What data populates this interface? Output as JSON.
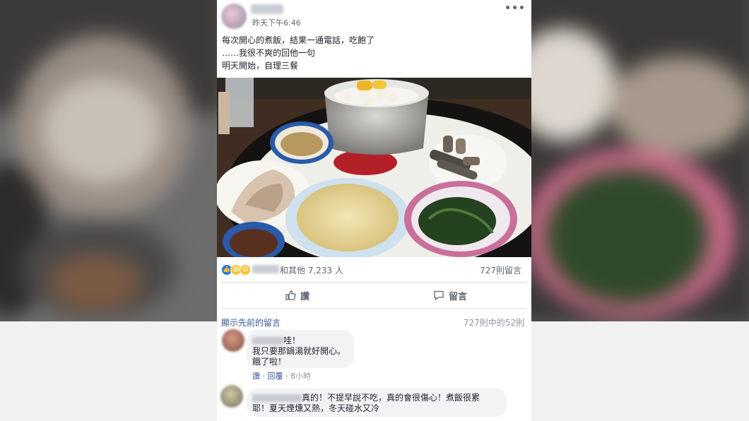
{
  "post": {
    "timestamp": "昨天下午6:46",
    "more_label": "•••",
    "text_lines": [
      "每次開心的煮飯，結果一通電話，吃飽了",
      "……我很不爽的回他一句",
      "明天開始，自理三餐"
    ]
  },
  "reactions": {
    "count_label": "和其他 7,233 人",
    "comments_label": "727則留言",
    "icons": [
      "like-icon",
      "haha-icon",
      "wow-icon"
    ]
  },
  "actions": {
    "like_label": "讚",
    "comment_label": "留言"
  },
  "comments_section": {
    "show_previous": "顯示先前的留言",
    "pager": "727則中的52則"
  },
  "comments": [
    {
      "lines": [
        "哇！",
        "我只要那鍋湯就好開心。",
        "餓了啦！"
      ],
      "like": "讚",
      "reply": "回覆",
      "time": "8小時"
    },
    {
      "lines": [
        "真的！不提早說不吃，真的會很傷心！煮飯很累",
        "耶！夏天煙燻又熱，冬天碰水又冷"
      ]
    }
  ],
  "colors": {
    "link": "#385898",
    "meta": "#606770",
    "bubble": "#f2f3f5",
    "like_blue": "#1877f2"
  }
}
